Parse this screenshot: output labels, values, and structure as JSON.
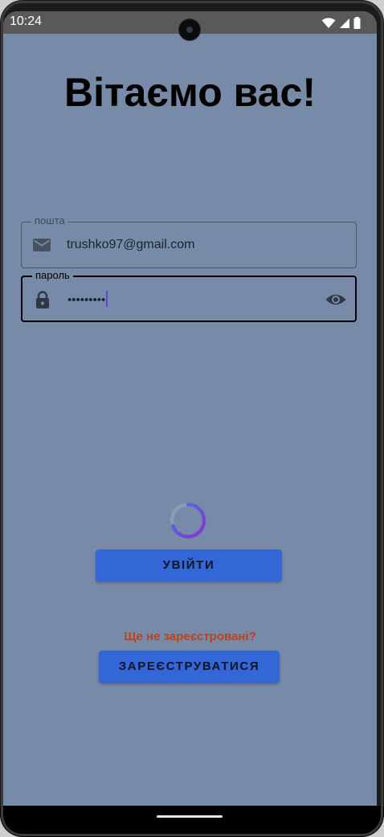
{
  "status_bar": {
    "time": "10:24",
    "icons": [
      "wifi-icon",
      "cellular-signal-icon",
      "battery-icon"
    ]
  },
  "page": {
    "title": "Вітаємо вас!"
  },
  "form": {
    "email": {
      "label": "пошта",
      "value": "trushko97@gmail.com",
      "icon": "mail-icon"
    },
    "password": {
      "label": "пароль",
      "value": "•••••••••",
      "icon": "lock-icon",
      "toggle_icon": "eye-icon"
    }
  },
  "actions": {
    "login_label": "УВІЙТИ",
    "register_prompt": "Ще не зареєстровані?",
    "register_label": "ЗАРЕЄСТРУВАТИСЯ"
  },
  "colors": {
    "background": "#778aa7",
    "button": "#3366d6",
    "prompt": "#c0401c",
    "spinner_start": "#3d7be0",
    "spinner_end": "#8b2fd3"
  },
  "loading": true
}
